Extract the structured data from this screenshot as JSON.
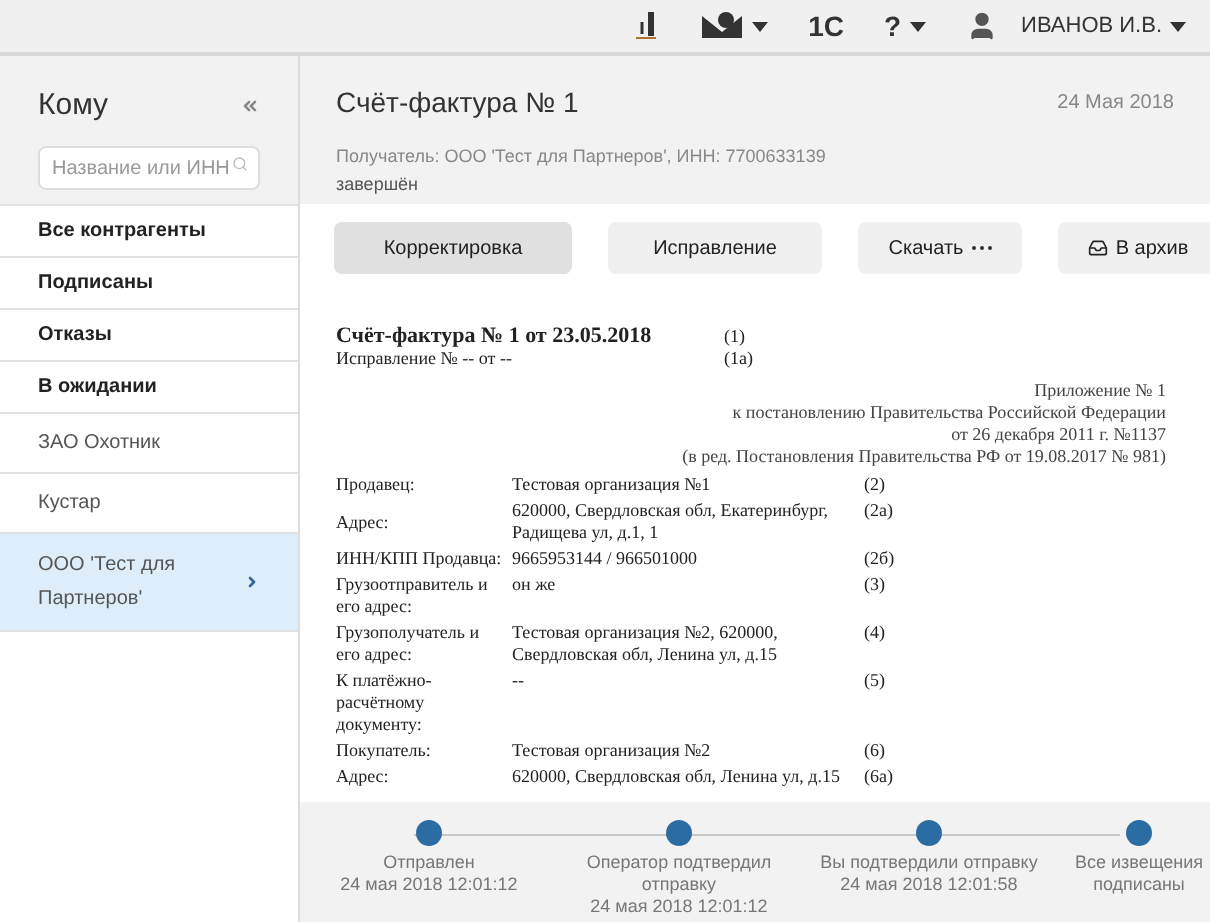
{
  "top_bar": {
    "user_name": "ИВАНОВ И.В.",
    "one_c_label": "1С",
    "help_label": "?"
  },
  "sidebar": {
    "title": "Кому",
    "search": {
      "placeholder": "Название или ИНН"
    },
    "items": [
      {
        "label": "Все контрагенты",
        "kind": "filter",
        "selected": false
      },
      {
        "label": "Подписаны",
        "kind": "filter",
        "selected": false
      },
      {
        "label": "Отказы",
        "kind": "filter",
        "selected": false
      },
      {
        "label": "В ожидании",
        "kind": "filter",
        "selected": false
      },
      {
        "label": "ЗАО Охотник",
        "kind": "contact",
        "selected": false
      },
      {
        "label": "Кустар",
        "kind": "contact",
        "selected": false
      },
      {
        "label": "ООО 'Тест для Партнеров'",
        "kind": "contact",
        "selected": true
      }
    ]
  },
  "document": {
    "title": "Счёт-фактура № 1",
    "date": "24 Мая 2018",
    "recipient": "Получатель: ООО 'Тест для Партнеров', ИНН: 7700633139",
    "status": "завершён",
    "actions": [
      {
        "label": "Корректировка",
        "kind": "primary"
      },
      {
        "label": "Исправление",
        "kind": "plain"
      },
      {
        "label": "Скачать",
        "kind": "menu"
      },
      {
        "label": "В архив",
        "kind": "archive"
      }
    ],
    "preview": {
      "heading": "Счёт-фактура № 1 от 23.05.2018",
      "heading_note": "(1)",
      "correction": "Исправление № -- от --",
      "correction_note": "(1а)",
      "appendix": [
        "Приложение № 1",
        "к постановлению Правительства Российской Федерации",
        "от 26 декабря 2011 г. №1137",
        "(в ред. Постановления Правительства РФ от 19.08.2017 № 981)"
      ],
      "rows": [
        {
          "label": "Продавец:",
          "value": "Тестовая организация №1",
          "note": "(2)"
        },
        {
          "label": "Адрес:",
          "value": "620000, Свердловская обл, Екатеринбург, Радищева ул, д.1, 1",
          "note": "(2а)"
        },
        {
          "label": "ИНН/КПП Продавца:",
          "value": "9665953144 / 966501000",
          "note": "(2б)"
        },
        {
          "label": "Грузоотправитель и его адрес:",
          "value": "он же",
          "note": "(3)"
        },
        {
          "label": "Грузополучатель и его адрес:",
          "value": "Тестовая организация №2, 620000, Свердловская обл, Ленина ул, д.15",
          "note": "(4)"
        },
        {
          "label": "К платёжно-расчётному документу:",
          "value": "--",
          "note": "(5)"
        },
        {
          "label": "Покупатель:",
          "value": "Тестовая организация №2",
          "note": "(6)"
        },
        {
          "label": "Адрес:",
          "value": "620000, Свердловская обл, Ленина ул, д.15",
          "note": "(6а)"
        }
      ]
    }
  },
  "timeline": [
    {
      "label": "Отправлен",
      "time": "24 мая 2018 12:01:12"
    },
    {
      "label": "Оператор подтвердил отправку",
      "time": "24 мая 2018 12:01:12"
    },
    {
      "label": "Вы подтвердили отправку",
      "time": "24 мая 2018 12:01:58"
    },
    {
      "label": "Все извещения подписаны"
    }
  ]
}
